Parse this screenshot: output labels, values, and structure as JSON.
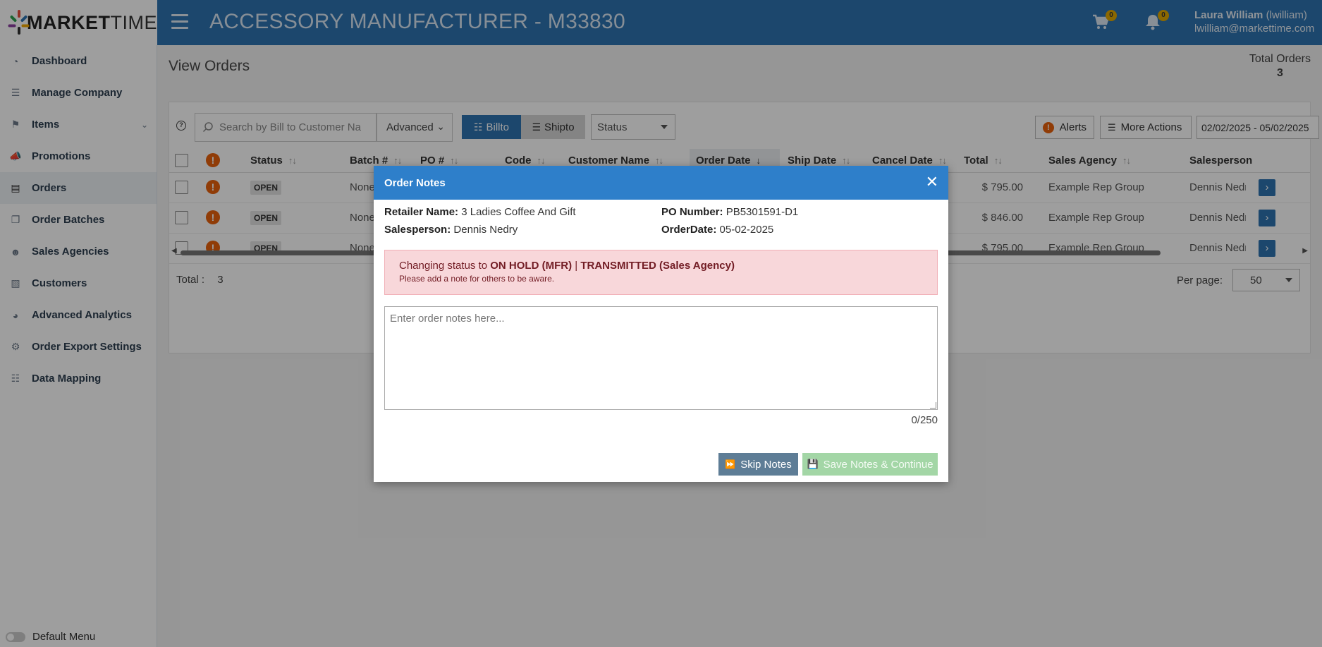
{
  "header": {
    "logo_bold": "MARKET",
    "logo_thin": "TIME",
    "title": "ACCESSORY MANUFACTURER - M33830",
    "cart_count": "0",
    "notif_count": "0",
    "user_name": "Laura William",
    "user_handle": "(lwilliam)",
    "user_email": "lwilliam@markettime.com"
  },
  "sidebar": {
    "items": [
      {
        "label": "Dashboard",
        "icon": "dashboard-icon"
      },
      {
        "label": "Manage Company",
        "icon": "list-icon"
      },
      {
        "label": "Items",
        "icon": "tags-icon"
      },
      {
        "label": "Promotions",
        "icon": "megaphone-icon"
      },
      {
        "label": "Orders",
        "icon": "document-icon"
      },
      {
        "label": "Order Batches",
        "icon": "files-icon"
      },
      {
        "label": "Sales Agencies",
        "icon": "users-icon"
      },
      {
        "label": "Customers",
        "icon": "id-card-icon"
      },
      {
        "label": "Advanced Analytics",
        "icon": "pie-chart-icon"
      },
      {
        "label": "Order Export Settings",
        "icon": "gears-icon"
      },
      {
        "label": "Data Mapping",
        "icon": "sitemap-icon"
      }
    ],
    "default_menu_label": "Default Menu"
  },
  "page": {
    "title": "View Orders",
    "total_orders_label": "Total Orders",
    "total_orders_value": "3"
  },
  "toolbar": {
    "search_placeholder": "Search by Bill to Customer Na",
    "advanced_label": "Advanced",
    "billto_label": "Billto",
    "shipto_label": "Shipto",
    "status_label": "Status",
    "alerts_label": "Alerts",
    "more_actions_label": "More Actions",
    "date_range": "02/02/2025 - 05/02/2025"
  },
  "table": {
    "headers": [
      "Status",
      "Batch #",
      "PO #",
      "Code",
      "Customer Name",
      "Order Date",
      "Ship Date",
      "Cancel Date",
      "Total",
      "Sales Agency",
      "Salesperson"
    ],
    "rows": [
      {
        "status": "OPEN",
        "batch": "None",
        "total": "$ 795.00",
        "agency": "Example Rep Group",
        "salesperson": "Dennis Nedry"
      },
      {
        "status": "OPEN",
        "batch": "None",
        "total": "$ 846.00",
        "agency": "Example Rep Group",
        "salesperson": "Dennis Nedry"
      },
      {
        "status": "OPEN",
        "batch": "None",
        "total": "$ 795.00",
        "agency": "Example Rep Group",
        "salesperson": "Dennis Nedry"
      }
    ],
    "footer_total_label": "Total :",
    "footer_total_value": "3",
    "per_page_label": "Per page:",
    "per_page_value": "50"
  },
  "modal": {
    "title": "Order Notes",
    "retailer_label": "Retailer Name:",
    "retailer_value": "3 Ladies Coffee And Gift",
    "po_label": "PO Number:",
    "po_value": "PB5301591-D1",
    "salesperson_label": "Salesperson:",
    "salesperson_value": "Dennis Nedry",
    "orderdate_label": "OrderDate:",
    "orderdate_value": "05-02-2025",
    "alert_prefix": "Changing status to",
    "alert_status_mfr": "ON HOLD (MFR)",
    "alert_sep": "|",
    "alert_status_agency": "TRANSMITTED (Sales Agency)",
    "alert_note": "Please add a note for others to be aware.",
    "notes_placeholder": "Enter order notes here...",
    "char_counter": "0/250",
    "skip_label": "Skip Notes",
    "save_label": "Save Notes & Continue"
  },
  "colors": {
    "header_blue": "#2e73b0",
    "modal_header_blue": "#2e7fca",
    "alert_bg": "#f8d7da",
    "alert_text": "#721c24",
    "warning_orange": "#e8620c",
    "save_green_disabled": "#a3d6a6",
    "skip_slate": "#5e7d96"
  }
}
